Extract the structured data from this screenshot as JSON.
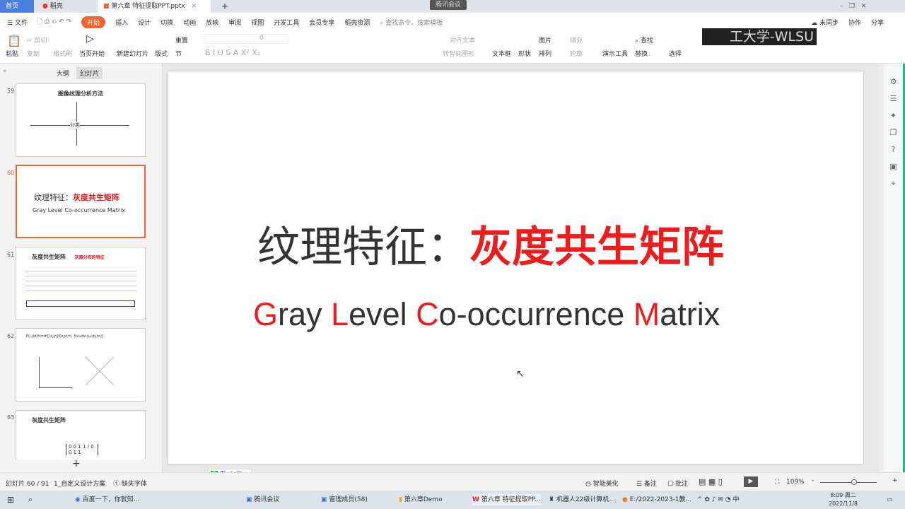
{
  "tabs": {
    "home": "首页",
    "daoke": "稻壳",
    "doc": "第六章 特征提取PPT.pptx",
    "new_tab": "+",
    "meeting_badge": "腾讯会议"
  },
  "menu": {
    "file": "文件",
    "items": [
      "开始",
      "插入",
      "设计",
      "切换",
      "动画",
      "放映",
      "审阅",
      "视图",
      "开发工具",
      "会员专享",
      "稻壳资源"
    ],
    "search": "查找命令、搜索模板",
    "sync": "未同步",
    "collab": "协作",
    "share": "分享"
  },
  "ribbon": {
    "paste": "粘贴",
    "cut": "剪切",
    "copy": "复制",
    "format_painter": "格式刷",
    "play_current": "当页开始",
    "new_slide": "新建幻灯片",
    "layout": "版式",
    "section": "节",
    "reset": "重置",
    "font_size": "0",
    "text_box": "文本框",
    "shape": "形状",
    "picture": "图片",
    "arrange": "排列",
    "fill": "填充",
    "outline": "轮廓",
    "present_tools": "演示工具",
    "find": "查找",
    "replace": "替换",
    "select": "选择",
    "align_text": "对齐文本",
    "smart_art": "转智能图形",
    "watermark": "工大学-WLSU"
  },
  "side": {
    "tab_outline": "大纲",
    "tab_slides": "幻灯片",
    "slides": [
      {
        "num": "59",
        "title": "图像纹理分析方法",
        "center": "分类"
      },
      {
        "num": "60",
        "title_black": "纹理特征：",
        "title_red": "灰度共生矩阵",
        "subtitle": "Gray Level Co-occurrence Matrix"
      },
      {
        "num": "61",
        "title": "灰度共生矩阵",
        "red": "灰度分布的特征"
      },
      {
        "num": "62",
        "formula": "P(i,j|d,θ)=#{(x,y)|f(x,y)=i, f(x+dx,y+dy)=j}"
      },
      {
        "num": "63",
        "title": "灰度共生矩阵",
        "matrix": "0 0 1 1 / 0 0 1 1"
      }
    ],
    "add": "+"
  },
  "slide": {
    "title_black": "纹理特征：",
    "title_red": "灰度共生矩阵",
    "subtitle_parts": [
      {
        "t": "G",
        "red": true
      },
      {
        "t": "ray ",
        "red": false
      },
      {
        "t": "L",
        "red": true
      },
      {
        "t": "evel ",
        "red": false
      },
      {
        "t": "C",
        "red": true
      },
      {
        "t": "o-occurrence ",
        "red": false
      },
      {
        "t": "M",
        "red": true
      },
      {
        "t": "atrix",
        "red": false
      }
    ]
  },
  "ime": {
    "items": [
      "五",
      "☽",
      "°,",
      "▦",
      "♟",
      "⁘"
    ]
  },
  "status": {
    "slide_count": "幻灯片 60 / 91",
    "theme": "1_自定义设计方案",
    "missing_font": "缺失字体",
    "beautify": "智能美化",
    "notes": "备注",
    "comment": "批注",
    "zoom": "109%",
    "minus": "-",
    "plus": "+"
  },
  "taskbar": {
    "items": [
      "百度一下，你就知...",
      "腾讯会议",
      "管理成员(58)",
      "第六章Demo",
      "第六章 特征提取PP...",
      "机器人22级计算机...",
      "E:/2022-2023-1教..."
    ],
    "time": "8:09 周二",
    "date": "2022/11/8",
    "ime": "中"
  },
  "colors": {
    "accent": "#f0642d",
    "red": "#ee1c1c",
    "green": "#14c77a"
  }
}
